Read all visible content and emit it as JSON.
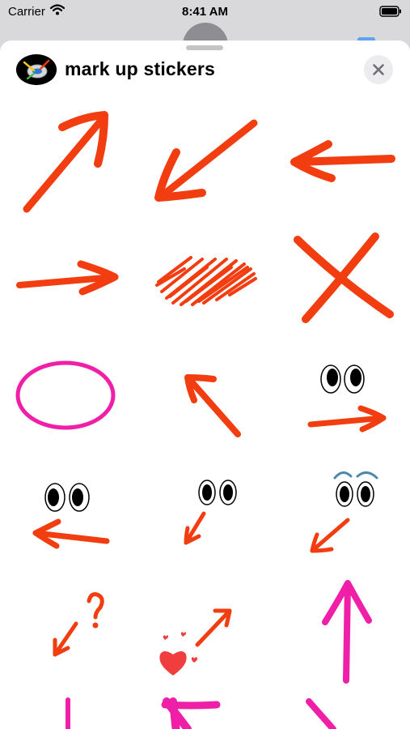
{
  "status_bar": {
    "carrier": "Carrier",
    "time": "8:41 AM"
  },
  "sheet": {
    "title": "mark up stickers"
  },
  "stickers": [
    {
      "name": "arrow-up-right"
    },
    {
      "name": "arrow-down-left"
    },
    {
      "name": "arrow-left"
    },
    {
      "name": "arrow-right"
    },
    {
      "name": "scribble"
    },
    {
      "name": "x-mark"
    },
    {
      "name": "pink-oval"
    },
    {
      "name": "arrow-up-left"
    },
    {
      "name": "eyes-arrow-right"
    },
    {
      "name": "eyes-arrow-left"
    },
    {
      "name": "eyes-arrow-down-left"
    },
    {
      "name": "eyebrows-eyes-arrow-down-left"
    },
    {
      "name": "question-mark-arrow"
    },
    {
      "name": "hearts-arrow"
    },
    {
      "name": "pink-arrow-up"
    },
    {
      "name": "pink-line-partial"
    },
    {
      "name": "pink-arrow-partial"
    },
    {
      "name": "pink-arrow-partial-right"
    }
  ],
  "colors": {
    "arrow_red": "#f23d10",
    "pink": "#f01fa8",
    "heart": "#f03d3d"
  }
}
